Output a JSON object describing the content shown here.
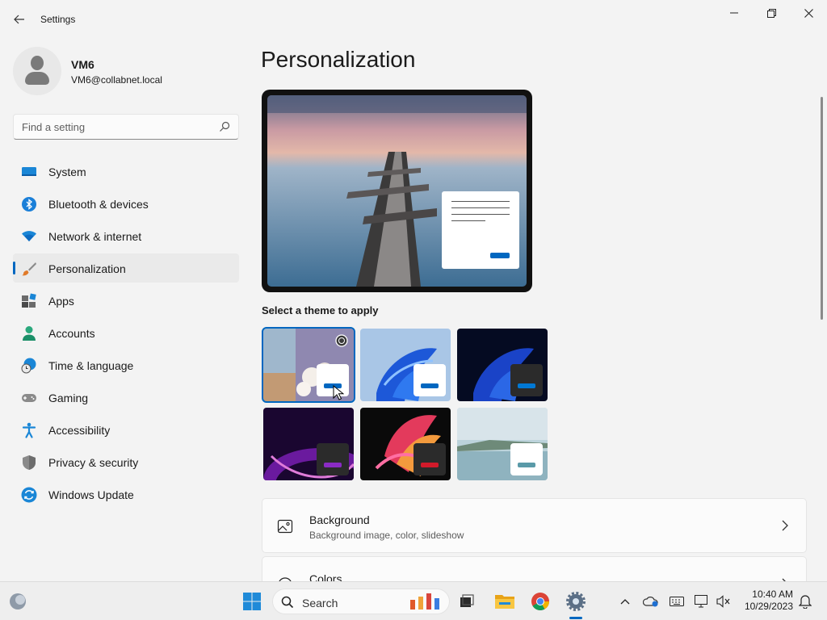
{
  "window": {
    "app_title": "Settings",
    "back_icon": "arrow-left-icon",
    "controls": [
      "minimize-icon",
      "restore-icon",
      "close-icon"
    ]
  },
  "profile": {
    "name": "VM6",
    "email": "VM6@collabnet.local"
  },
  "search": {
    "placeholder": "Find a setting"
  },
  "sidebar": {
    "items": [
      {
        "label": "System",
        "icon": "system-icon"
      },
      {
        "label": "Bluetooth & devices",
        "icon": "bluetooth-icon"
      },
      {
        "label": "Network & internet",
        "icon": "wifi-icon"
      },
      {
        "label": "Personalization",
        "icon": "brush-icon",
        "active": true
      },
      {
        "label": "Apps",
        "icon": "apps-icon"
      },
      {
        "label": "Accounts",
        "icon": "accounts-icon"
      },
      {
        "label": "Time & language",
        "icon": "time-language-icon"
      },
      {
        "label": "Gaming",
        "icon": "gamepad-icon"
      },
      {
        "label": "Accessibility",
        "icon": "accessibility-icon"
      },
      {
        "label": "Privacy & security",
        "icon": "shield-icon"
      },
      {
        "label": "Windows Update",
        "icon": "windows-update-icon"
      }
    ]
  },
  "main": {
    "title": "Personalization",
    "theme_heading": "Select a theme to apply",
    "themes": [
      {
        "name": "custom-flowers",
        "selected": true
      },
      {
        "name": "windows-light"
      },
      {
        "name": "windows-dark"
      },
      {
        "name": "glow"
      },
      {
        "name": "captured-motion"
      },
      {
        "name": "flow"
      }
    ],
    "cards": [
      {
        "title": "Background",
        "subtitle": "Background image, color, slideshow",
        "icon": "image-icon"
      },
      {
        "title": "Colors",
        "subtitle": "",
        "icon": "palette-icon"
      }
    ]
  },
  "taskbar": {
    "search_label": "Search",
    "time": "10:40 AM",
    "date": "10/29/2023",
    "apps": [
      "start-icon",
      "task-view-icon",
      "file-explorer-icon",
      "chrome-icon",
      "settings-icon"
    ],
    "tray": [
      "chevron-up-icon",
      "onedrive-icon",
      "keyboard-icon",
      "display-icon",
      "speaker-muted-icon",
      "notification-bell-icon"
    ]
  },
  "colors": {
    "accent": "#0067c0",
    "window_bg": "#f3f3f3",
    "card_bg": "#fbfbfb"
  }
}
